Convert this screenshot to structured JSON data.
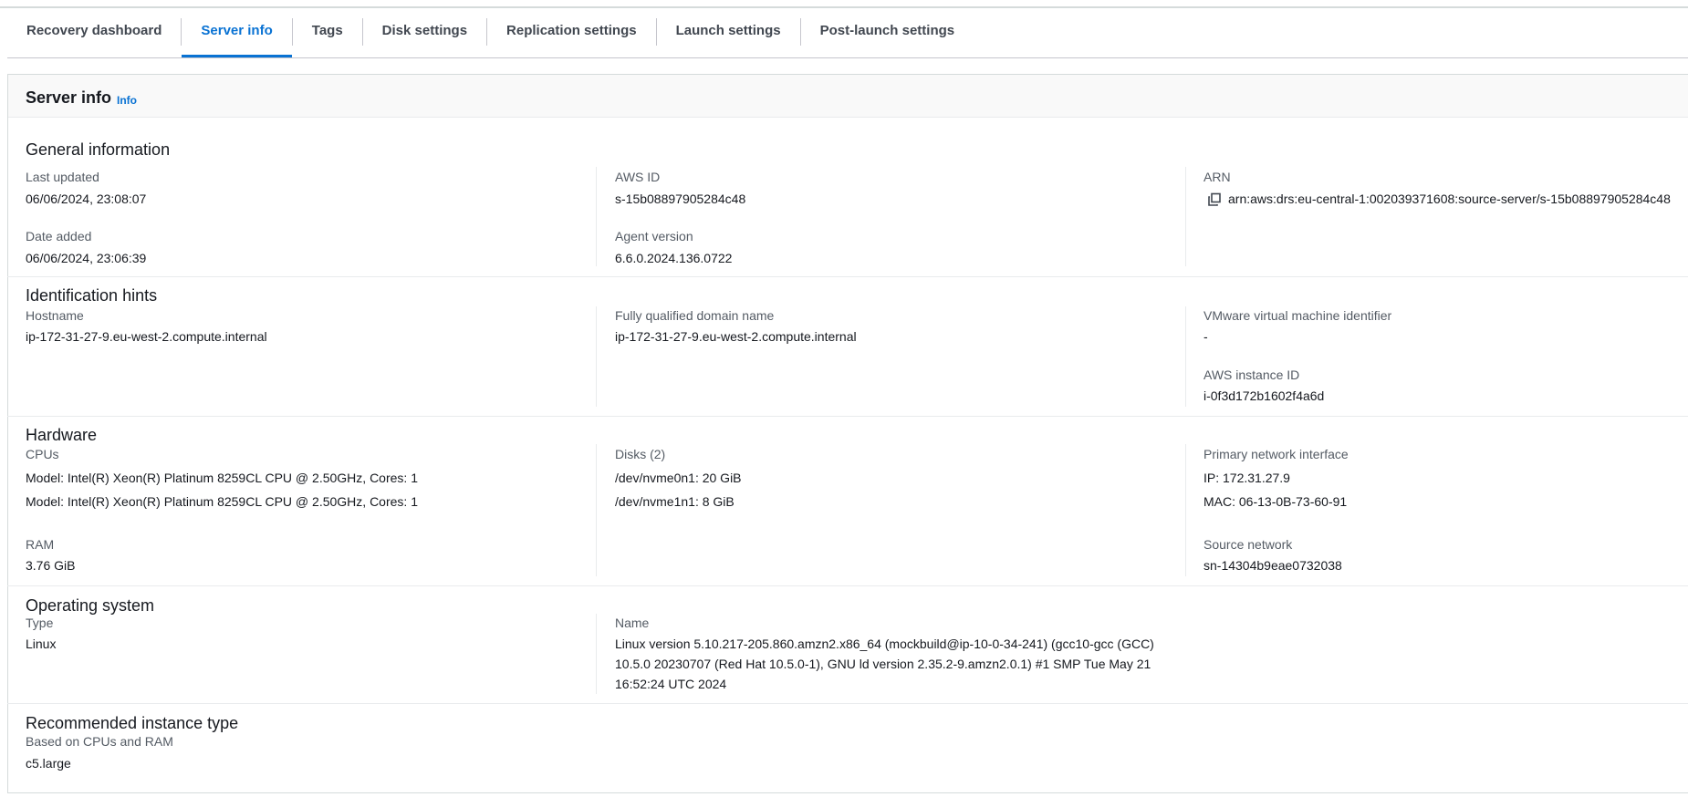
{
  "tabs": [
    {
      "label": "Recovery dashboard",
      "active": false
    },
    {
      "label": "Server info",
      "active": true
    },
    {
      "label": "Tags",
      "active": false
    },
    {
      "label": "Disk settings",
      "active": false
    },
    {
      "label": "Replication settings",
      "active": false
    },
    {
      "label": "Launch settings",
      "active": false
    },
    {
      "label": "Post-launch settings",
      "active": false
    }
  ],
  "container": {
    "title": "Server info",
    "info_link": "Info"
  },
  "general": {
    "title": "General information",
    "last_updated_label": "Last updated",
    "last_updated": "06/06/2024, 23:08:07",
    "date_added_label": "Date added",
    "date_added": "06/06/2024, 23:06:39",
    "aws_id_label": "AWS ID",
    "aws_id": "s-15b08897905284c48",
    "agent_version_label": "Agent version",
    "agent_version": "6.6.0.2024.136.0722",
    "arn_label": "ARN",
    "arn": "arn:aws:drs:eu-central-1:002039371608:source-server/s-15b08897905284c48"
  },
  "identification": {
    "title": "Identification hints",
    "hostname_label": "Hostname",
    "hostname": "ip-172-31-27-9.eu-west-2.compute.internal",
    "fqdn_label": "Fully qualified domain name",
    "fqdn": "ip-172-31-27-9.eu-west-2.compute.internal",
    "vmware_label": "VMware virtual machine identifier",
    "vmware": "-",
    "instance_id_label": "AWS instance ID",
    "instance_id": "i-0f3d172b1602f4a6d"
  },
  "hardware": {
    "title": "Hardware",
    "cpus_label": "CPUs",
    "cpus": [
      "Model: Intel(R) Xeon(R) Platinum 8259CL CPU @ 2.50GHz, Cores: 1",
      "Model: Intel(R) Xeon(R) Platinum 8259CL CPU @ 2.50GHz, Cores: 1"
    ],
    "ram_label": "RAM",
    "ram": "3.76 GiB",
    "disks_label": "Disks (2)",
    "disks": [
      "/dev/nvme0n1: 20 GiB",
      "/dev/nvme1n1: 8 GiB"
    ],
    "nic_label": "Primary network interface",
    "ip": "IP: 172.31.27.9",
    "mac": "MAC: 06-13-0B-73-60-91",
    "source_network_label": "Source network",
    "source_network": "sn-14304b9eae0732038"
  },
  "os": {
    "title": "Operating system",
    "type_label": "Type",
    "type": "Linux",
    "name_label": "Name",
    "name_lines": [
      "Linux version 5.10.217-205.860.amzn2.x86_64 (mockbuild@ip-10-0-34-241) (gcc10-gcc (GCC)",
      "10.5.0 20230707 (Red Hat 10.5.0-1), GNU ld version 2.35.2-9.amzn2.0.1) #1 SMP Tue May 21",
      "16:52:24 UTC 2024"
    ]
  },
  "recommended": {
    "title": "Recommended instance type",
    "based_label": "Based on CPUs and RAM",
    "value": "c5.large"
  }
}
